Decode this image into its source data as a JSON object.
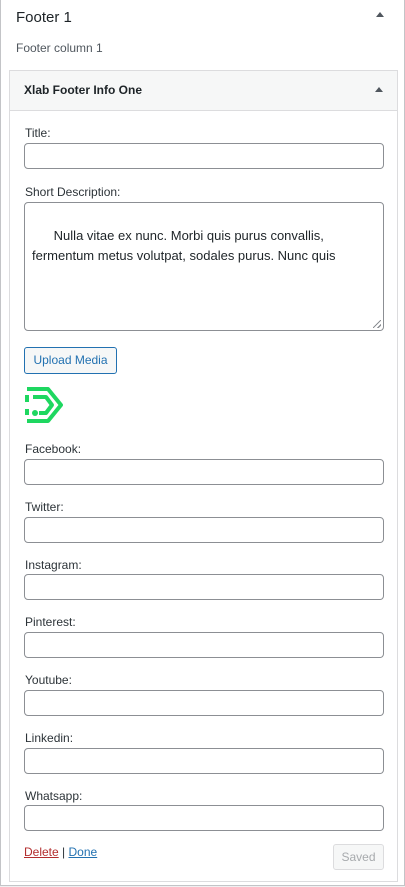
{
  "sidebar": {
    "title": "Footer 1",
    "description": "Footer column 1"
  },
  "widget": {
    "title": "Xlab Footer Info One",
    "fields": {
      "title": {
        "label": "Title:",
        "value": ""
      },
      "short_description": {
        "label": "Short Description:",
        "value": "Nulla vitae ex nunc. Morbi quis purus convallis, fermentum metus volutpat, sodales purus. Nunc quis"
      },
      "upload_label": "Upload Media",
      "logo": {
        "icon": "xlab-logo-icon",
        "color": "#1ed760"
      },
      "social": [
        {
          "label": "Facebook:",
          "value": ""
        },
        {
          "label": "Twitter:",
          "value": ""
        },
        {
          "label": "Instagram:",
          "value": ""
        },
        {
          "label": "Pinterest:",
          "value": ""
        },
        {
          "label": "Youtube:",
          "value": ""
        },
        {
          "label": "Linkedin:",
          "value": ""
        },
        {
          "label": "Whatsapp:",
          "value": ""
        }
      ]
    },
    "actions": {
      "delete_label": "Delete",
      "separator": "|",
      "done_label": "Done",
      "saved_label": "Saved"
    }
  }
}
